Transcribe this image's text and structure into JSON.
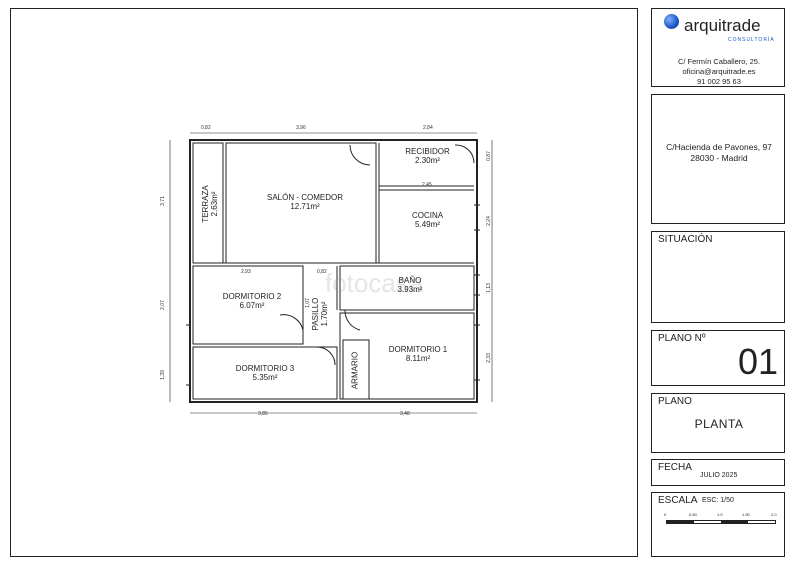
{
  "company": {
    "name": "arquitrade",
    "tagline": "CONSULTORÍA",
    "address": "C/ Fermín Caballero, 25.",
    "email": "oficina@arquitrade.es",
    "phone": "91 002 95 63",
    "accent_color": "#1a56c4"
  },
  "property": {
    "address_line1": "C/Hacienda de Pavones, 97",
    "address_line2": "28030 - Madrid"
  },
  "situacion": {
    "title": "SITUACIÓN",
    "map_icon": "map-pin-icon"
  },
  "plano_no": {
    "title": "PLANO Nº",
    "value": "01"
  },
  "plano": {
    "title": "PLANO",
    "value": "PLANTA"
  },
  "fecha": {
    "title": "FECHA",
    "value": "JULIO 2025"
  },
  "escala": {
    "title": "ESCALA",
    "value": "ESC: 1/50",
    "ticks": [
      "0",
      "0.50",
      "1.0",
      "1.50",
      "2.0"
    ]
  },
  "watermark": "fotocasa",
  "rooms": {
    "terraza": {
      "name": "TERRAZA",
      "area": "2.63m²"
    },
    "salon": {
      "name": "SALÓN  - COMEDOR",
      "area": "12.71m²"
    },
    "recibidor": {
      "name": "RECIBIDOR",
      "area": "2.30m²"
    },
    "cocina": {
      "name": "COCINA",
      "area": "5.49m²"
    },
    "bano": {
      "name": "BAÑO",
      "area": "3.93m²"
    },
    "dormitorio1": {
      "name": "DORMITORIO 1",
      "area": "8.11m²"
    },
    "dormitorio2": {
      "name": "DORMITORIO 2",
      "area": "6.07m²"
    },
    "dormitorio3": {
      "name": "DORMITORIO 3",
      "area": "5.35m²"
    },
    "pasillo": {
      "name": "PASILLO",
      "area": "1.70m²"
    },
    "armario": {
      "name": "ARMARIO"
    }
  },
  "dimensions": {
    "top": [
      "0,82",
      "3,96",
      "2,84"
    ],
    "bottom": [
      "3,85",
      "3,48"
    ],
    "left": [
      "3,71",
      "2,07",
      "1,39"
    ],
    "right": [
      "0,87",
      "2,24",
      "1,13",
      "2,33"
    ],
    "inner": [
      "2,45",
      "2,93",
      "0,82",
      "1,07"
    ]
  }
}
